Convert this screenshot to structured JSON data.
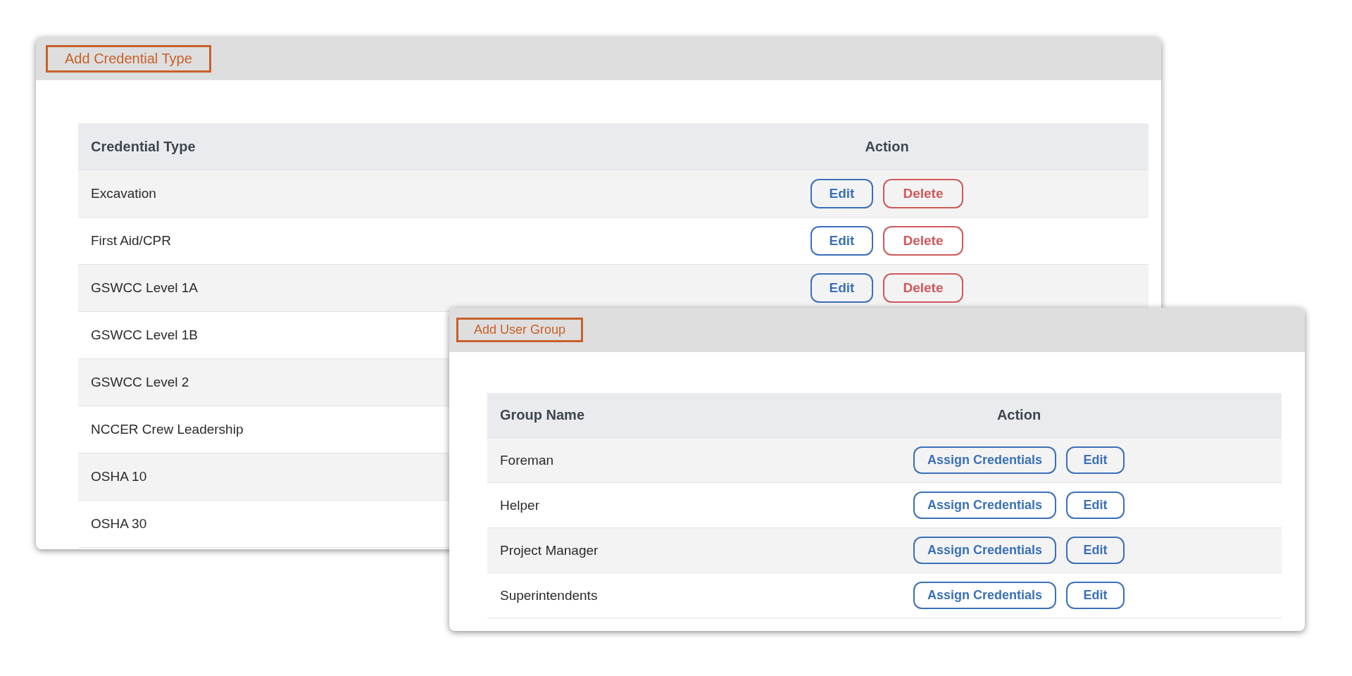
{
  "windows": [
    {
      "header_button": "Add Credential Type",
      "table": {
        "columns": [
          "Credential Type",
          "Action"
        ],
        "rows": [
          {
            "name": "Excavation",
            "actions": [
              {
                "label": "Edit",
                "kind": "edit"
              },
              {
                "label": "Delete",
                "kind": "delete"
              }
            ]
          },
          {
            "name": "First Aid/CPR",
            "actions": [
              {
                "label": "Edit",
                "kind": "edit"
              },
              {
                "label": "Delete",
                "kind": "delete"
              }
            ]
          },
          {
            "name": "GSWCC Level 1A",
            "actions": [
              {
                "label": "Edit",
                "kind": "edit"
              },
              {
                "label": "Delete",
                "kind": "delete"
              }
            ]
          },
          {
            "name": "GSWCC Level 1B"
          },
          {
            "name": "GSWCC Level 2"
          },
          {
            "name": "NCCER Crew Leadership"
          },
          {
            "name": "OSHA 10"
          },
          {
            "name": "OSHA 30"
          }
        ]
      }
    },
    {
      "header_button": "Add User Group",
      "table": {
        "columns": [
          "Group Name",
          "Action"
        ],
        "rows": [
          {
            "name": "Foreman",
            "actions": [
              {
                "label": "Assign Credentials",
                "kind": "edit"
              },
              {
                "label": "Edit",
                "kind": "edit"
              }
            ]
          },
          {
            "name": "Helper",
            "actions": [
              {
                "label": "Assign Credentials",
                "kind": "edit"
              },
              {
                "label": "Edit",
                "kind": "edit"
              }
            ]
          },
          {
            "name": "Project Manager",
            "actions": [
              {
                "label": "Assign Credentials",
                "kind": "edit"
              },
              {
                "label": "Edit",
                "kind": "edit"
              }
            ]
          },
          {
            "name": "Superintendents",
            "actions": [
              {
                "label": "Assign Credentials",
                "kind": "edit"
              },
              {
                "label": "Edit",
                "kind": "edit"
              }
            ]
          }
        ]
      }
    }
  ]
}
